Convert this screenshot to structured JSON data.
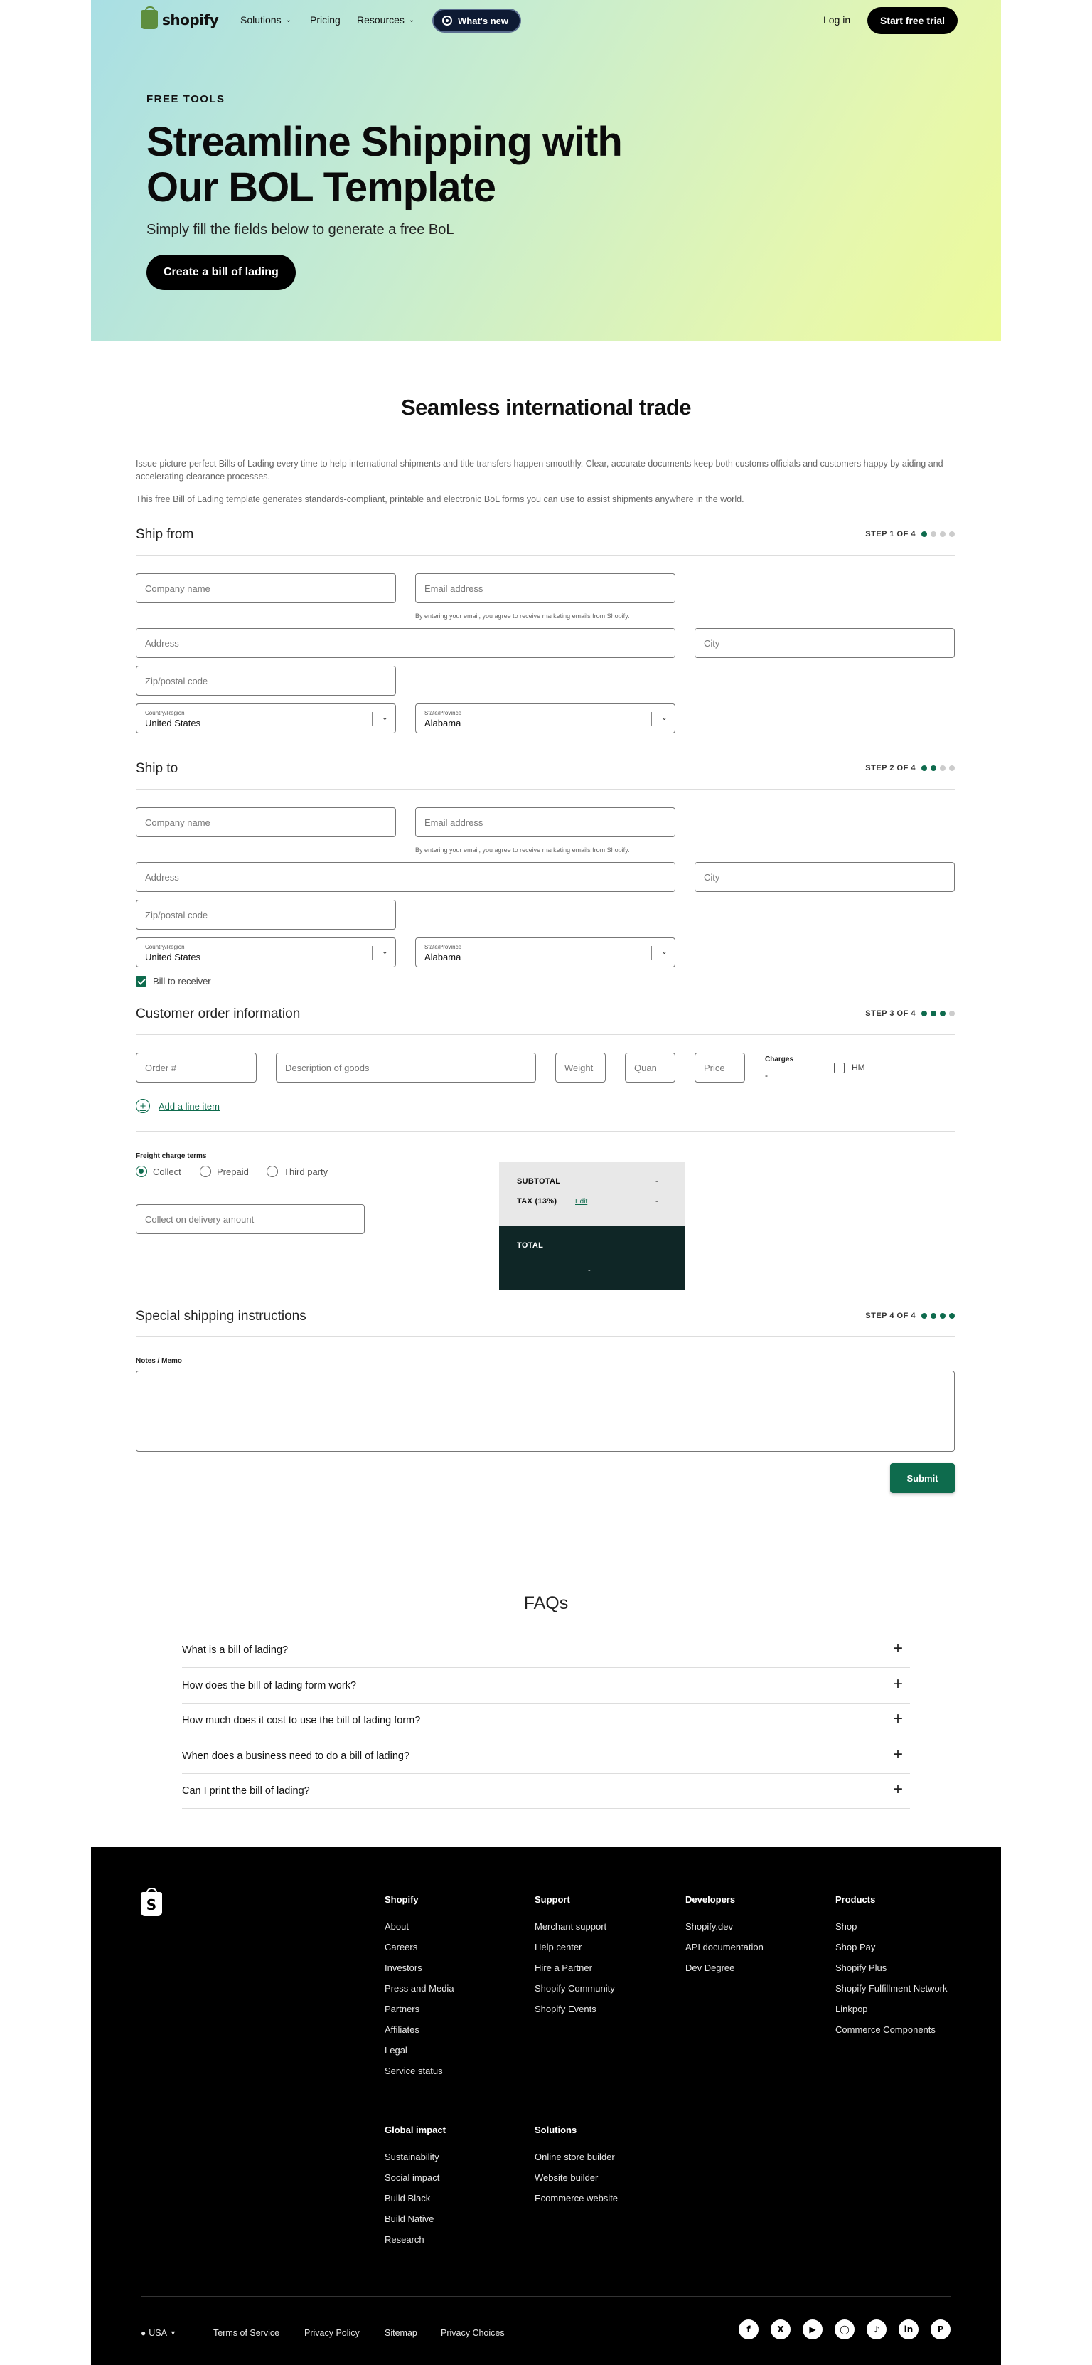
{
  "nav": {
    "logo_text": "shopify",
    "solutions": "Solutions",
    "pricing": "Pricing",
    "resources": "Resources",
    "whats_new": "What's new",
    "login": "Log in",
    "trial": "Start free trial"
  },
  "hero": {
    "eyebrow": "FREE TOOLS",
    "title": "Streamline Shipping with Our BOL Template",
    "subtitle": "Simply fill the fields below to generate a free BoL",
    "cta": "Create a bill of lading"
  },
  "intro": {
    "title": "Seamless international trade",
    "p1": "Issue picture-perfect Bills of Lading every time to help international shipments and title transfers happen smoothly. Clear, accurate documents keep both customs officials and customers happy by aiding and accelerating clearance processes.",
    "p2": "This free Bill of Lading template generates standards-compliant, printable and electronic BoL forms you can use to assist shipments anywhere in the world."
  },
  "ship_from": {
    "title": "Ship from",
    "step": "STEP 1 OF 4",
    "company": "Company name",
    "email": "Email address",
    "email_hint": "By entering your email, you agree to receive marketing emails from Shopify.",
    "address": "Address",
    "city": "City",
    "zip": "Zip/postal code",
    "country_label": "Country/Region",
    "country": "United States",
    "state_label": "State/Province",
    "state": "Alabama"
  },
  "ship_to": {
    "title": "Ship to",
    "step": "STEP 2 OF 4",
    "company": "Company name",
    "email": "Email address",
    "email_hint": "By entering your email, you agree to receive marketing emails from Shopify.",
    "address": "Address",
    "city": "City",
    "zip": "Zip/postal code",
    "country_label": "Country/Region",
    "country": "United States",
    "state_label": "State/Province",
    "state": "Alabama",
    "bill_to_receiver": "Bill to receiver"
  },
  "order": {
    "title": "Customer order information",
    "step": "STEP 3 OF 4",
    "order_no": "Order #",
    "description": "Description of goods",
    "weight": "Weight",
    "quantity": "Quan",
    "price": "Price",
    "charges_label": "Charges",
    "charges_value": "-",
    "hm": "HM",
    "add_line": "Add a line item",
    "freight_label": "Freight charge terms",
    "freight_options": [
      "Collect",
      "Prepaid",
      "Third party"
    ],
    "cod": "Collect on delivery amount",
    "subtotal_label": "SUBTOTAL",
    "subtotal_value": "-",
    "tax_label": "TAX (13%)",
    "tax_edit": "Edit",
    "tax_value": "-",
    "total_label": "TOTAL",
    "total_value": "-"
  },
  "special": {
    "title": "Special shipping instructions",
    "step": "STEP 4 OF 4",
    "notes_label": "Notes / Memo",
    "submit": "Submit"
  },
  "faq": {
    "title": "FAQs",
    "items": [
      "What is a bill of lading?",
      "How does the bill of lading form work?",
      "How much does it cost to use the bill of lading form?",
      "When does a business need to do a bill of lading?",
      "Can I print the bill of lading?"
    ]
  },
  "footer": {
    "shopify": {
      "title": "Shopify",
      "links": [
        "About",
        "Careers",
        "Investors",
        "Press and Media",
        "Partners",
        "Affiliates",
        "Legal",
        "Service status"
      ]
    },
    "support": {
      "title": "Support",
      "links": [
        "Merchant support",
        "Help center",
        "Hire a Partner",
        "Shopify Community",
        "Shopify Events"
      ]
    },
    "developers": {
      "title": "Developers",
      "links": [
        "Shopify.dev",
        "API documentation",
        "Dev Degree"
      ]
    },
    "products": {
      "title": "Products",
      "links": [
        "Shop",
        "Shop Pay",
        "Shopify Plus",
        "Shopify Fulfillment Network",
        "Linkpop",
        "Commerce Components"
      ]
    },
    "global": {
      "title": "Global impact",
      "links": [
        "Sustainability",
        "Social impact",
        "Build Black",
        "Build Native",
        "Research"
      ]
    },
    "solutions": {
      "title": "Solutions",
      "links": [
        "Online store builder",
        "Website builder",
        "Ecommerce website"
      ]
    },
    "region": "USA",
    "bottom_links": [
      "Terms of Service",
      "Privacy Policy",
      "Sitemap",
      "Privacy Choices"
    ],
    "social_icons": [
      "facebook-icon",
      "x-icon",
      "youtube-icon",
      "instagram-icon",
      "tiktok-icon",
      "linkedin-icon",
      "pinterest-icon"
    ]
  },
  "colors": {
    "accent": "#0e6b4d",
    "total_bg": "#0f2626",
    "footer_bg": "#000000"
  }
}
